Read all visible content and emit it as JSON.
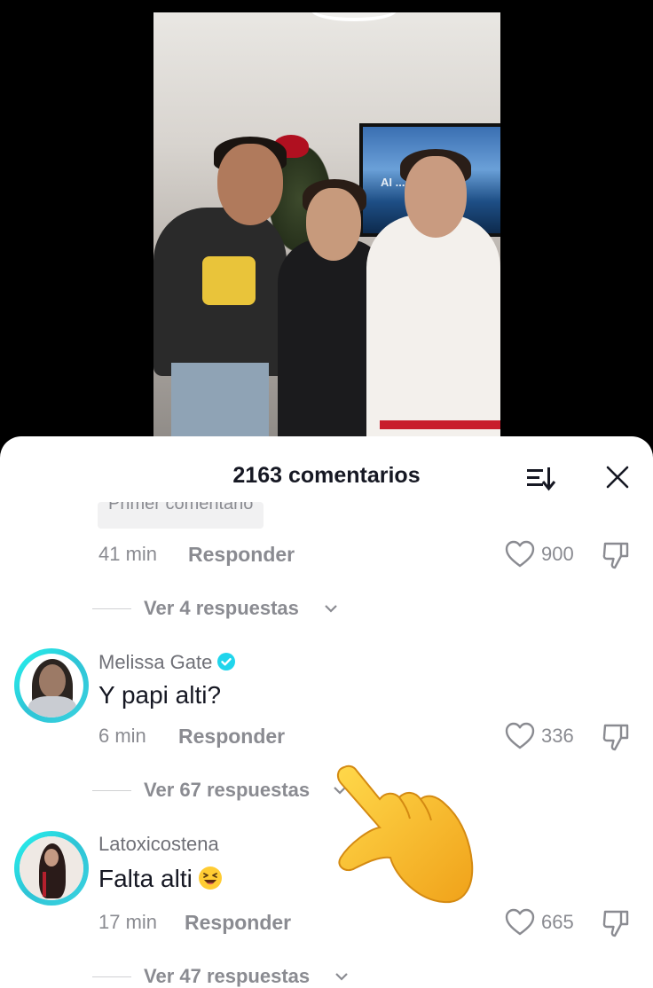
{
  "sheet": {
    "title": "2163 comentarios"
  },
  "pinned_comment": {
    "tag": "Primer comentario",
    "time": "41 min",
    "reply_label": "Responder",
    "likes": "900",
    "view_replies": "Ver 4 respuestas"
  },
  "comments": [
    {
      "username": "Melissa Gate",
      "verified": true,
      "text": "Y papi alti?",
      "time": "6 min",
      "reply_label": "Responder",
      "likes": "336",
      "view_replies": "Ver 67 respuestas"
    },
    {
      "username": "Latoxicostena",
      "verified": false,
      "text": "Falta alti",
      "emoji": "laughing-face",
      "time": "17 min",
      "reply_label": "Responder",
      "likes": "665",
      "view_replies": "Ver 47 respuestas"
    }
  ],
  "icons": {
    "sort": "sort-icon",
    "close": "close-icon",
    "like": "heart-icon",
    "dislike": "thumbs-down-icon",
    "verified": "verified-badge-icon",
    "pointer": "pointing-hand-emoji"
  },
  "colors": {
    "verified": "#20d5ec",
    "avatar_ring": "#25f4ee",
    "text_primary": "#161823",
    "text_secondary": "#8a8b91"
  }
}
